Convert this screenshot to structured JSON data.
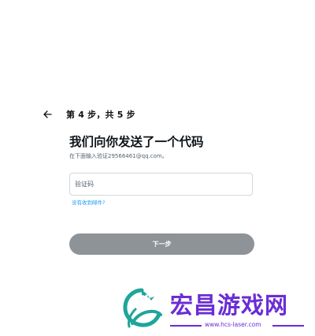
{
  "header": {
    "back_icon": "arrow-left-icon",
    "step_text": "第 4 步，共 5 步"
  },
  "main": {
    "title": "我们向你发送了一个代码",
    "subtitle": "在下面输入验证29566461@qq.com。",
    "code_input": {
      "placeholder": "验证码",
      "value": ""
    },
    "resend_link": "没有收到邮件?",
    "next_button": "下一步"
  },
  "watermark": {
    "logo_icon": "dragon-logo-icon",
    "title": "宏昌游戏网",
    "url": "www.hcs-laser.com"
  },
  "colors": {
    "link": "#1d9bf0",
    "button_disabled": "#8e9398",
    "watermark_purple": "#6a2dd4",
    "logo_teal": "#1fa59a"
  }
}
